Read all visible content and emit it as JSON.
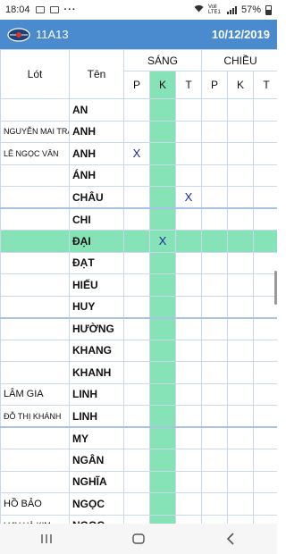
{
  "status": {
    "time": "18:04",
    "battery": "57%",
    "dots": "···",
    "net": "Voll LTE1"
  },
  "app": {
    "class_name": "11A13",
    "date": "10/12/2019",
    "accent": "#4a8bd0"
  },
  "table": {
    "headers": {
      "lot": "Lót",
      "ten": "Tên",
      "sang": "SÁNG",
      "chieu": "CHIỀU",
      "p": "P",
      "k": "K",
      "t": "T"
    },
    "highlight_color": "#86e3b8",
    "rows": [
      {
        "lot": "",
        "ten": "AN",
        "marks": [
          "",
          "",
          "",
          "",
          "",
          ""
        ]
      },
      {
        "lot": "NGUYỄN MAI TRÂM",
        "ten": "ANH",
        "marks": [
          "",
          "",
          "",
          "",
          "",
          ""
        ]
      },
      {
        "lot": "LÊ NGỌC VÂN",
        "ten": "ANH",
        "marks": [
          "X",
          "",
          "",
          "",
          "",
          ""
        ]
      },
      {
        "lot": "",
        "ten": "ÁNH",
        "marks": [
          "",
          "",
          "",
          "",
          "",
          ""
        ]
      },
      {
        "lot": "",
        "ten": "CHÂU",
        "marks": [
          "",
          "",
          "X",
          "",
          "",
          ""
        ]
      },
      {
        "lot": "",
        "ten": "CHI",
        "marks": [
          "",
          "",
          "",
          "",
          "",
          ""
        ]
      },
      {
        "lot": "",
        "ten": "ĐẠI",
        "marks": [
          "",
          "X",
          "",
          "",
          "",
          ""
        ],
        "selected": true
      },
      {
        "lot": "",
        "ten": "ĐẠT",
        "marks": [
          "",
          "",
          "",
          "",
          "",
          ""
        ]
      },
      {
        "lot": "",
        "ten": "HIẾU",
        "marks": [
          "",
          "",
          "",
          "",
          "",
          ""
        ]
      },
      {
        "lot": "",
        "ten": "HUY",
        "marks": [
          "",
          "",
          "",
          "",
          "",
          ""
        ]
      },
      {
        "lot": "",
        "ten": "HƯỜNG",
        "marks": [
          "",
          "",
          "",
          "",
          "",
          ""
        ]
      },
      {
        "lot": "",
        "ten": "KHANG",
        "marks": [
          "",
          "",
          "",
          "",
          "",
          ""
        ]
      },
      {
        "lot": "",
        "ten": "KHANH",
        "marks": [
          "",
          "",
          "",
          "",
          "",
          ""
        ]
      },
      {
        "lot": "LÂM GIA",
        "ten": "LINH",
        "marks": [
          "",
          "",
          "",
          "",
          "",
          ""
        ]
      },
      {
        "lot": "ĐỖ THỊ KHÁNH",
        "ten": "LINH",
        "marks": [
          "",
          "",
          "",
          "",
          "",
          ""
        ]
      },
      {
        "lot": "",
        "ten": "MY",
        "marks": [
          "",
          "",
          "",
          "",
          "",
          ""
        ]
      },
      {
        "lot": "",
        "ten": "NGÂN",
        "marks": [
          "",
          "",
          "",
          "",
          "",
          ""
        ]
      },
      {
        "lot": "",
        "ten": "NGHĨA",
        "marks": [
          "",
          "",
          "",
          "",
          "",
          ""
        ]
      },
      {
        "lot": "HỒ BẢO",
        "ten": "NGỌC",
        "marks": [
          "",
          "",
          "",
          "",
          "",
          ""
        ]
      },
      {
        "lot": "LƯU HÀ KIM",
        "ten": "NGỌC",
        "marks": [
          "",
          "",
          "",
          "",
          "",
          ""
        ]
      }
    ]
  },
  "nav": {
    "recent": "recent-apps-icon",
    "home": "home-icon",
    "back": "back-icon"
  }
}
